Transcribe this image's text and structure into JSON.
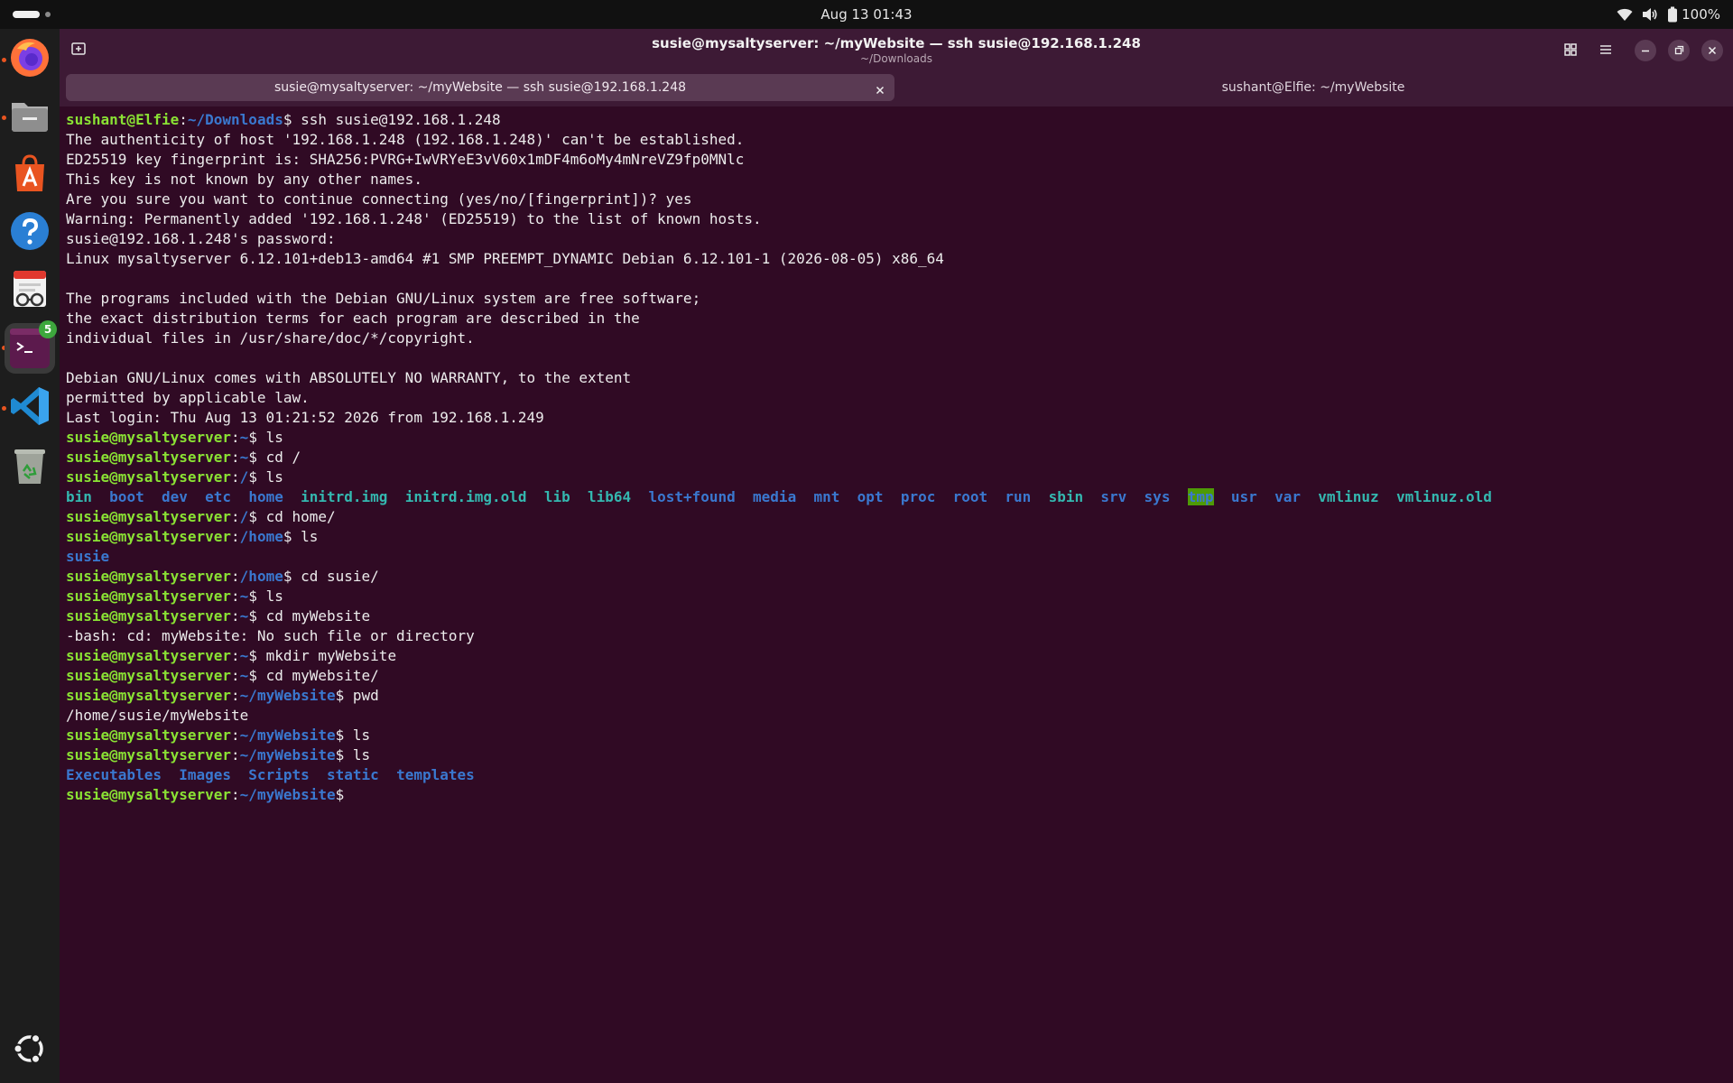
{
  "topbar": {
    "clock": "Aug 13  01:43",
    "battery": "100%"
  },
  "dock": {
    "items": [
      {
        "name": "Firefox",
        "icon": "firefox-icon"
      },
      {
        "name": "Files",
        "icon": "files-icon"
      },
      {
        "name": "App Center",
        "icon": "app-center-icon"
      },
      {
        "name": "Help",
        "icon": "help-icon"
      },
      {
        "name": "Document Viewer",
        "icon": "document-viewer-icon"
      },
      {
        "name": "Terminal",
        "icon": "terminal-icon",
        "badge": "5"
      },
      {
        "name": "Visual Studio Code",
        "icon": "vscode-icon"
      },
      {
        "name": "Trash",
        "icon": "trash-icon"
      },
      {
        "name": "Show Apps",
        "icon": "ubuntu-logo-icon"
      }
    ]
  },
  "window": {
    "title": "susie@mysaltyserver: ~/myWebsite — ssh susie@192.168.1.248",
    "subtitle": "~/Downloads",
    "tabs": [
      {
        "label": "susie@mysaltyserver: ~/myWebsite — ssh susie@192.168.1.248",
        "active": true
      },
      {
        "label": "sushant@Elfie: ~/myWebsite",
        "active": false
      }
    ]
  },
  "terminal": {
    "lines": [
      {
        "segs": [
          {
            "t": "sushant@Elfie",
            "c": "user"
          },
          {
            "t": ":"
          },
          {
            "t": "~/Downloads",
            "c": "path"
          },
          {
            "t": "$ ssh susie@192.168.1.248"
          }
        ]
      },
      {
        "segs": [
          {
            "t": "The authenticity of host '192.168.1.248 (192.168.1.248)' can't be established."
          }
        ]
      },
      {
        "segs": [
          {
            "t": "ED25519 key fingerprint is: SHA256:PVRG+IwVRYeE3vV60x1mDF4m6oMy4mNreVZ9fp0MNlc"
          }
        ]
      },
      {
        "segs": [
          {
            "t": "This key is not known by any other names."
          }
        ]
      },
      {
        "segs": [
          {
            "t": "Are you sure you want to continue connecting (yes/no/[fingerprint])? yes"
          }
        ]
      },
      {
        "segs": [
          {
            "t": "Warning: Permanently added '192.168.1.248' (ED25519) to the list of known hosts."
          }
        ]
      },
      {
        "segs": [
          {
            "t": "susie@192.168.1.248's password:"
          }
        ]
      },
      {
        "segs": [
          {
            "t": "Linux mysaltyserver 6.12.101+deb13-amd64 #1 SMP PREEMPT_DYNAMIC Debian 6.12.101-1 (2026-08-05) x86_64"
          }
        ]
      },
      {
        "segs": [
          {
            "t": ""
          }
        ]
      },
      {
        "segs": [
          {
            "t": "The programs included with the Debian GNU/Linux system are free software;"
          }
        ]
      },
      {
        "segs": [
          {
            "t": "the exact distribution terms for each program are described in the"
          }
        ]
      },
      {
        "segs": [
          {
            "t": "individual files in /usr/share/doc/*/copyright."
          }
        ]
      },
      {
        "segs": [
          {
            "t": ""
          }
        ]
      },
      {
        "segs": [
          {
            "t": "Debian GNU/Linux comes with ABSOLUTELY NO WARRANTY, to the extent"
          }
        ]
      },
      {
        "segs": [
          {
            "t": "permitted by applicable law."
          }
        ]
      },
      {
        "segs": [
          {
            "t": "Last login: Thu Aug 13 01:21:52 2026 from 192.168.1.249"
          }
        ]
      },
      {
        "segs": [
          {
            "t": "susie@mysaltyserver",
            "c": "user"
          },
          {
            "t": ":"
          },
          {
            "t": "~",
            "c": "path"
          },
          {
            "t": "$ ls"
          }
        ]
      },
      {
        "segs": [
          {
            "t": "susie@mysaltyserver",
            "c": "user"
          },
          {
            "t": ":"
          },
          {
            "t": "~",
            "c": "path"
          },
          {
            "t": "$ cd /"
          }
        ]
      },
      {
        "segs": [
          {
            "t": "susie@mysaltyserver",
            "c": "user"
          },
          {
            "t": ":"
          },
          {
            "t": "/",
            "c": "path"
          },
          {
            "t": "$ ls"
          }
        ]
      },
      {
        "segs": [
          {
            "t": "bin",
            "c": "lnk"
          },
          {
            "t": "  "
          },
          {
            "t": "boot",
            "c": "dir"
          },
          {
            "t": "  "
          },
          {
            "t": "dev",
            "c": "dir"
          },
          {
            "t": "  "
          },
          {
            "t": "etc",
            "c": "dir"
          },
          {
            "t": "  "
          },
          {
            "t": "home",
            "c": "dir"
          },
          {
            "t": "  "
          },
          {
            "t": "initrd.img",
            "c": "lnk"
          },
          {
            "t": "  "
          },
          {
            "t": "initrd.img.old",
            "c": "lnk"
          },
          {
            "t": "  "
          },
          {
            "t": "lib",
            "c": "lnk"
          },
          {
            "t": "  "
          },
          {
            "t": "lib64",
            "c": "lnk"
          },
          {
            "t": "  "
          },
          {
            "t": "lost+found",
            "c": "dir"
          },
          {
            "t": "  "
          },
          {
            "t": "media",
            "c": "dir"
          },
          {
            "t": "  "
          },
          {
            "t": "mnt",
            "c": "dir"
          },
          {
            "t": "  "
          },
          {
            "t": "opt",
            "c": "dir"
          },
          {
            "t": "  "
          },
          {
            "t": "proc",
            "c": "dir"
          },
          {
            "t": "  "
          },
          {
            "t": "root",
            "c": "dir"
          },
          {
            "t": "  "
          },
          {
            "t": "run",
            "c": "dir"
          },
          {
            "t": "  "
          },
          {
            "t": "sbin",
            "c": "lnk"
          },
          {
            "t": "  "
          },
          {
            "t": "srv",
            "c": "dir"
          },
          {
            "t": "  "
          },
          {
            "t": "sys",
            "c": "dir"
          },
          {
            "t": "  "
          },
          {
            "t": "tmp",
            "c": "sticky"
          },
          {
            "t": "  "
          },
          {
            "t": "usr",
            "c": "dir"
          },
          {
            "t": "  "
          },
          {
            "t": "var",
            "c": "dir"
          },
          {
            "t": "  "
          },
          {
            "t": "vmlinuz",
            "c": "lnk"
          },
          {
            "t": "  "
          },
          {
            "t": "vmlinuz.old",
            "c": "lnk"
          }
        ]
      },
      {
        "segs": [
          {
            "t": "susie@mysaltyserver",
            "c": "user"
          },
          {
            "t": ":"
          },
          {
            "t": "/",
            "c": "path"
          },
          {
            "t": "$ cd home/"
          }
        ]
      },
      {
        "segs": [
          {
            "t": "susie@mysaltyserver",
            "c": "user"
          },
          {
            "t": ":"
          },
          {
            "t": "/home",
            "c": "path"
          },
          {
            "t": "$ ls"
          }
        ]
      },
      {
        "segs": [
          {
            "t": "susie",
            "c": "dir"
          }
        ]
      },
      {
        "segs": [
          {
            "t": "susie@mysaltyserver",
            "c": "user"
          },
          {
            "t": ":"
          },
          {
            "t": "/home",
            "c": "path"
          },
          {
            "t": "$ cd susie/"
          }
        ]
      },
      {
        "segs": [
          {
            "t": "susie@mysaltyserver",
            "c": "user"
          },
          {
            "t": ":"
          },
          {
            "t": "~",
            "c": "path"
          },
          {
            "t": "$ ls"
          }
        ]
      },
      {
        "segs": [
          {
            "t": "susie@mysaltyserver",
            "c": "user"
          },
          {
            "t": ":"
          },
          {
            "t": "~",
            "c": "path"
          },
          {
            "t": "$ cd myWebsite"
          }
        ]
      },
      {
        "segs": [
          {
            "t": "-bash: cd: myWebsite: No such file or directory"
          }
        ]
      },
      {
        "segs": [
          {
            "t": "susie@mysaltyserver",
            "c": "user"
          },
          {
            "t": ":"
          },
          {
            "t": "~",
            "c": "path"
          },
          {
            "t": "$ mkdir myWebsite"
          }
        ]
      },
      {
        "segs": [
          {
            "t": "susie@mysaltyserver",
            "c": "user"
          },
          {
            "t": ":"
          },
          {
            "t": "~",
            "c": "path"
          },
          {
            "t": "$ cd myWebsite/"
          }
        ]
      },
      {
        "segs": [
          {
            "t": "susie@mysaltyserver",
            "c": "user"
          },
          {
            "t": ":"
          },
          {
            "t": "~/myWebsite",
            "c": "path"
          },
          {
            "t": "$ pwd"
          }
        ]
      },
      {
        "segs": [
          {
            "t": "/home/susie/myWebsite"
          }
        ]
      },
      {
        "segs": [
          {
            "t": "susie@mysaltyserver",
            "c": "user"
          },
          {
            "t": ":"
          },
          {
            "t": "~/myWebsite",
            "c": "path"
          },
          {
            "t": "$ ls"
          }
        ]
      },
      {
        "segs": [
          {
            "t": "susie@mysaltyserver",
            "c": "user"
          },
          {
            "t": ":"
          },
          {
            "t": "~/myWebsite",
            "c": "path"
          },
          {
            "t": "$ ls"
          }
        ]
      },
      {
        "segs": [
          {
            "t": "Executables",
            "c": "dir"
          },
          {
            "t": "  "
          },
          {
            "t": "Images",
            "c": "dir"
          },
          {
            "t": "  "
          },
          {
            "t": "Scripts",
            "c": "dir"
          },
          {
            "t": "  "
          },
          {
            "t": "static",
            "c": "dir"
          },
          {
            "t": "  "
          },
          {
            "t": "templates",
            "c": "dir"
          }
        ]
      },
      {
        "segs": [
          {
            "t": "susie@mysaltyserver",
            "c": "user"
          },
          {
            "t": ":"
          },
          {
            "t": "~/myWebsite",
            "c": "path"
          },
          {
            "t": "$ "
          }
        ]
      }
    ]
  }
}
